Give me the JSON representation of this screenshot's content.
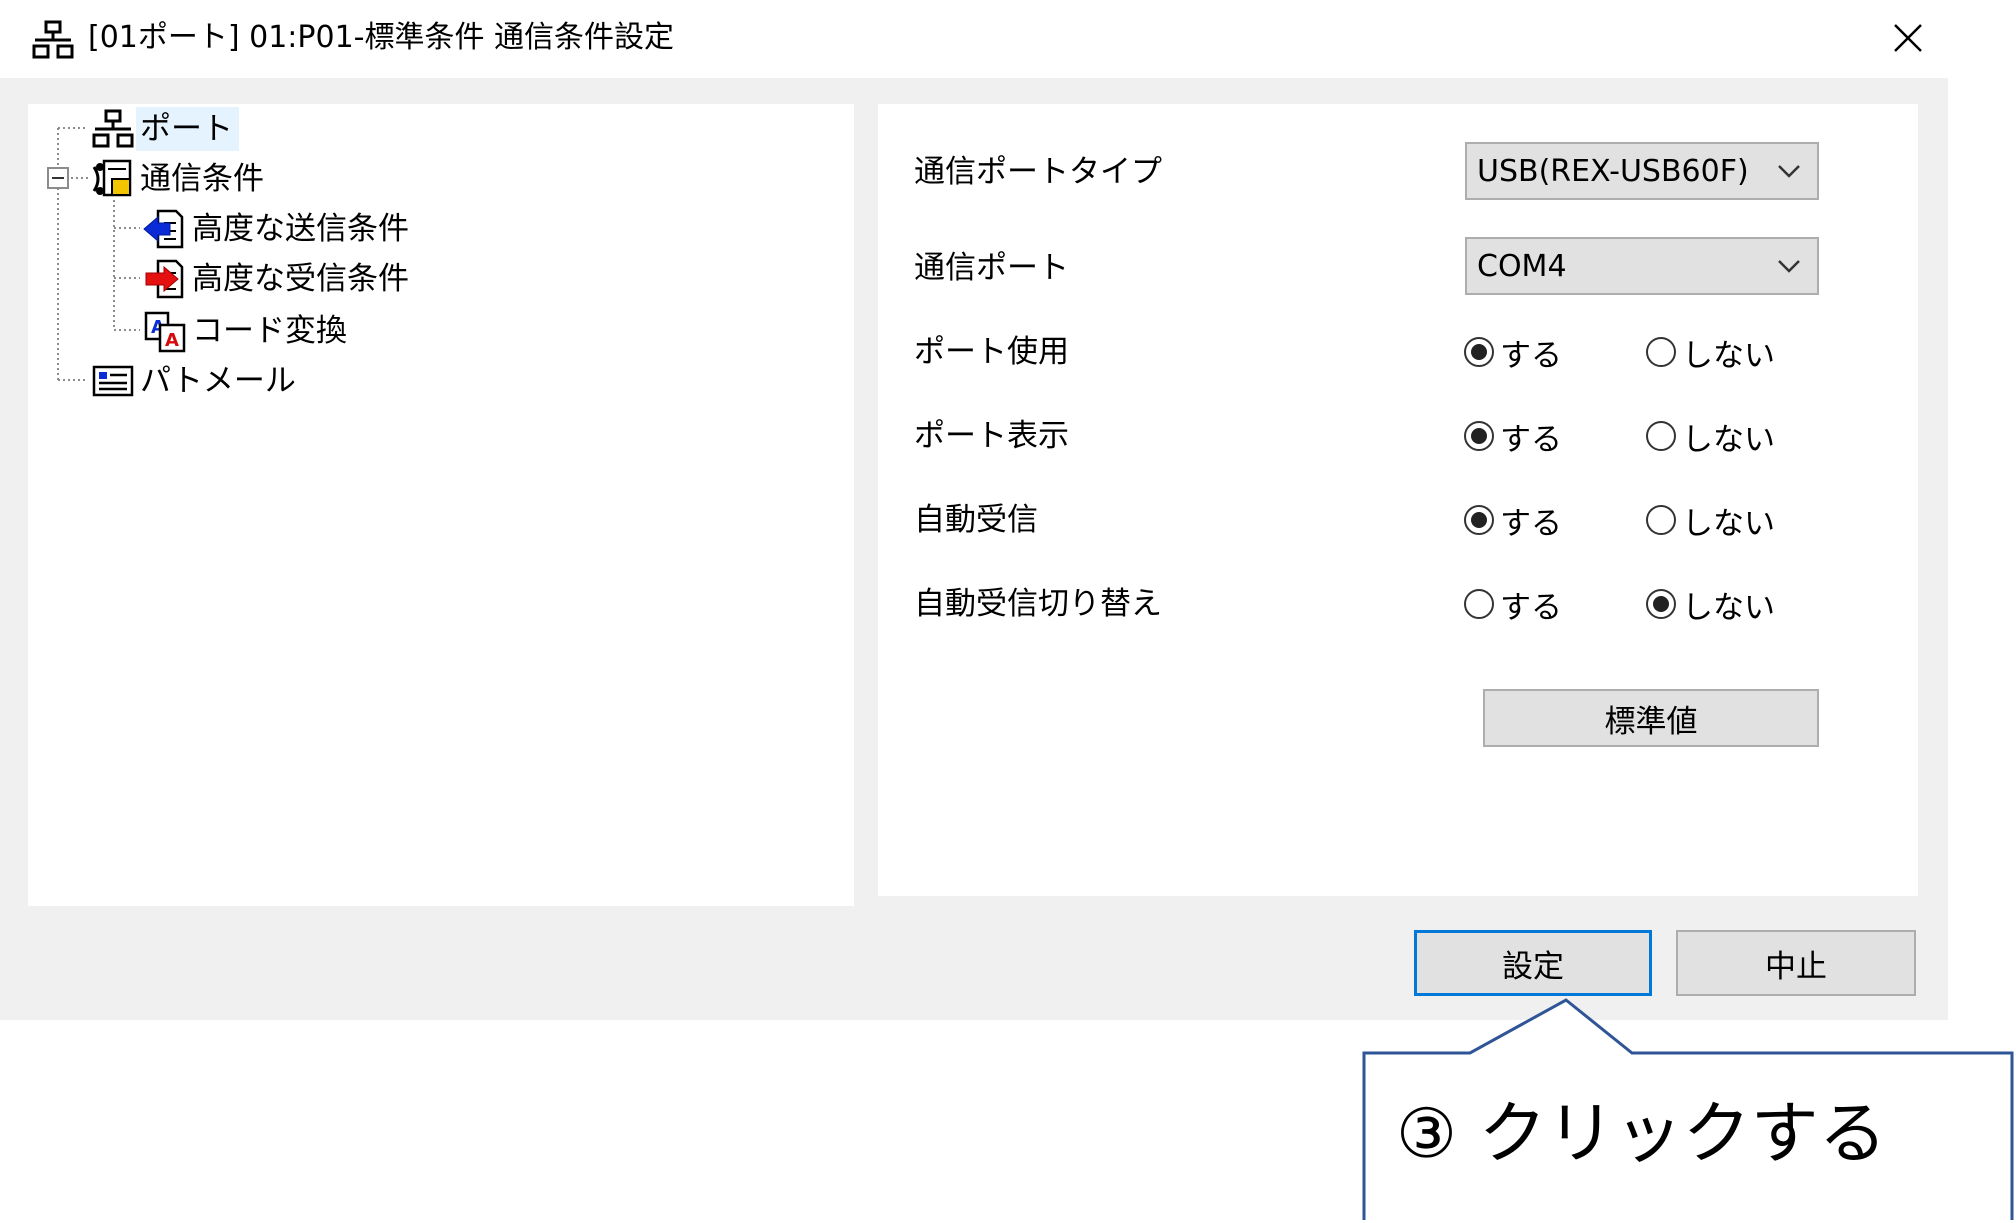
{
  "window": {
    "title": "[01ポート] 01:P01-標準条件 通信条件設定"
  },
  "tree": {
    "items": [
      {
        "label": "ポート",
        "icon": "network-icon"
      },
      {
        "label": "通信条件",
        "icon": "comm-settings-icon"
      },
      {
        "label": "高度な送信条件",
        "icon": "send-arrow-icon"
      },
      {
        "label": "高度な受信条件",
        "icon": "receive-arrow-icon"
      },
      {
        "label": "コード変換",
        "icon": "code-convert-icon"
      },
      {
        "label": "パトメール",
        "icon": "mail-card-icon"
      }
    ]
  },
  "settings": {
    "port_type_label": "通信ポートタイプ",
    "port_type_value": "USB(REX-USB60F)",
    "port_label": "通信ポート",
    "port_value": "COM4",
    "rows": [
      {
        "label": "ポート使用",
        "yes": "する",
        "no": "しない",
        "selected": "yes"
      },
      {
        "label": "ポート表示",
        "yes": "する",
        "no": "しない",
        "selected": "yes"
      },
      {
        "label": "自動受信",
        "yes": "する",
        "no": "しない",
        "selected": "yes"
      },
      {
        "label": "自動受信切り替え",
        "yes": "する",
        "no": "しない",
        "selected": "no"
      }
    ],
    "default_button": "標準値"
  },
  "footer": {
    "ok_button": "設定",
    "cancel_button": "中止"
  },
  "annotation": {
    "text": "③ クリックする",
    "border_color": "#2f5597"
  }
}
